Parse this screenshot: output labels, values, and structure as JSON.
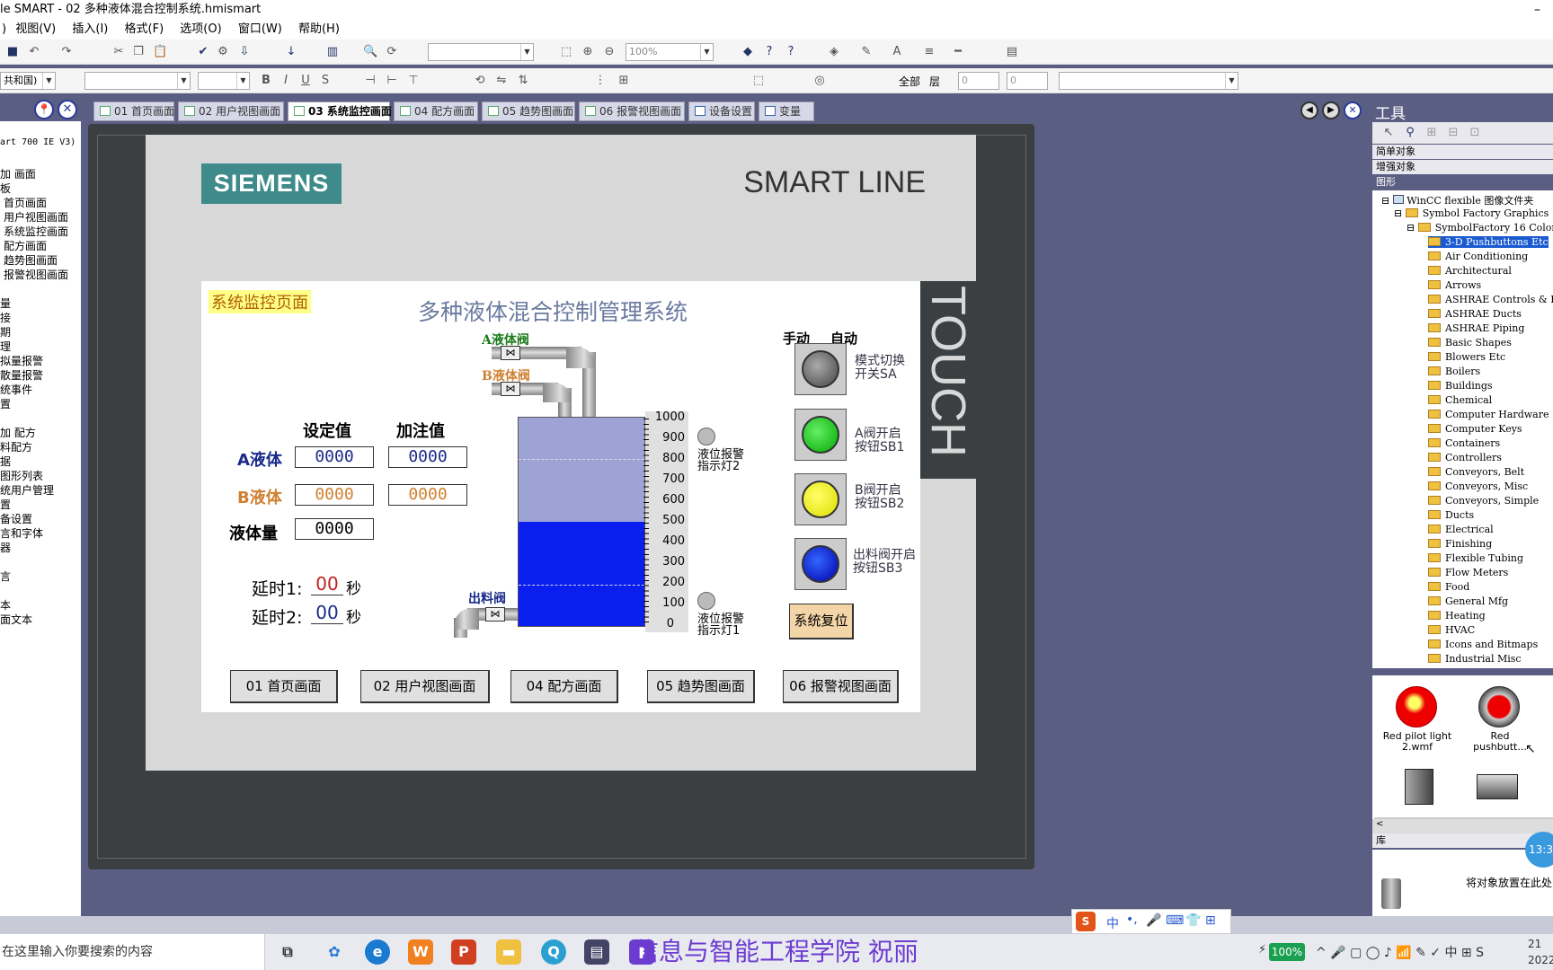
{
  "window": {
    "title": "le SMART - 02 多种液体混合控制系统.hmismart",
    "min_symbol": "–"
  },
  "menu": [
    "视图(V)",
    "插入(I)",
    "格式(F)",
    "选项(O)",
    "窗口(W)",
    "帮助(H)"
  ],
  "toolbar": {
    "zoom": "100%",
    "locale": "共和国)",
    "all_label": "全部",
    "layer_label": "层",
    "spin1": "0",
    "spin2": "0"
  },
  "left_tree": {
    "device": "art 700 IE V3)",
    "items": [
      "加 画面",
      "板",
      "首页画面",
      "用户视图画面",
      "系统监控画面",
      "配方画面",
      "趋势图画面",
      "报警视图画面",
      "量",
      "接",
      "期",
      "理",
      "拟量报警",
      "散量报警",
      "统事件",
      "置",
      "加 配方",
      "料配方",
      "据",
      "图形列表",
      "统用户管理",
      "置",
      "备设置",
      "言和字体",
      "器",
      "言",
      "本",
      "面文本"
    ]
  },
  "tabs": [
    "01 首页画面",
    "02 用户视图画面",
    "03 系统监控画面",
    "04 配方画面",
    "05 趋势图画面",
    "06 报警视图画面",
    "设备设置",
    "变量"
  ],
  "device": {
    "brand": "SIEMENS",
    "line": "SMART LINE",
    "touch": "TOUCH"
  },
  "screen": {
    "page_label": "系统监控页面",
    "system_title": "多种液体混合控制管理系统",
    "col_setpoint": "设定值",
    "col_fill": "加注值",
    "row_a": "A液体",
    "row_b": "B液体",
    "row_qty": "液体量",
    "a_set": "0000",
    "a_fill": "0000",
    "b_set": "0000",
    "b_fill": "0000",
    "qty": "0000",
    "delay1_label": "延时1:",
    "delay1": "00",
    "delay2_label": "延时2:",
    "delay2": "00",
    "sec": "秒",
    "valve_a": "A液体阀",
    "valve_b": "B液体阀",
    "valve_out": "出料阀",
    "scale": [
      "1000",
      "900",
      "800",
      "700",
      "600",
      "500",
      "400",
      "300",
      "200",
      "100",
      "0"
    ],
    "lamp2_label": "液位报警\n指示灯2",
    "lamp1_label": "液位报警\n指示灯1",
    "manual": "手动",
    "auto": "自动",
    "mode_label": "模式切换\n开关SA",
    "sb1_label": "A阀开启\n按钮SB1",
    "sb2_label": "B阀开启\n按钮SB2",
    "sb3_label": "出料阀开启\n按钮SB3",
    "reset": "系统复位",
    "nav": [
      "01 首页画面",
      "02 用户视图画面",
      "04 配方画面",
      "05 趋势图画面",
      "06 报警视图画面"
    ]
  },
  "tools": {
    "title": "工具",
    "sections": [
      "简单对象",
      "增强对象",
      "图形"
    ],
    "tree": [
      "WinCC flexible 图像文件夹",
      "Symbol Factory Graphics",
      "SymbolFactory 16 Colors",
      "3-D Pushbuttons Etc",
      "Air Conditioning",
      "Architectural",
      "Arrows",
      "ASHRAE Controls & E",
      "ASHRAE Ducts",
      "ASHRAE Piping",
      "Basic Shapes",
      "Blowers Etc",
      "Boilers",
      "Buildings",
      "Chemical",
      "Computer Hardware",
      "Computer Keys",
      "Containers",
      "Controllers",
      "Conveyors, Belt",
      "Conveyors, Misc",
      "Conveyors, Simple",
      "Ducts",
      "Electrical",
      "Finishing",
      "Flexible Tubing",
      "Flow Meters",
      "Food",
      "General Mfg",
      "Heating",
      "HVAC",
      "Icons and Bitmaps",
      "Industrial Misc"
    ],
    "gallery": [
      "Red pilot light 2.wmf",
      "Red pushbutt..."
    ],
    "lib_title": "库",
    "lib_hint": "将对象放置在此处",
    "badge": "13:3"
  },
  "taskbar": {
    "search": "在这里输入你要搜索的内容",
    "watermark": "信息与智能工程学院  祝丽",
    "battery": "100%",
    "clock1": "21",
    "clock2": "2022"
  },
  "colors": {
    "accent": "#3f8a8a",
    "tank_fill": "#0a1ef0",
    "tank_top": "#9ea3d6",
    "bg": "#5a5e82"
  }
}
